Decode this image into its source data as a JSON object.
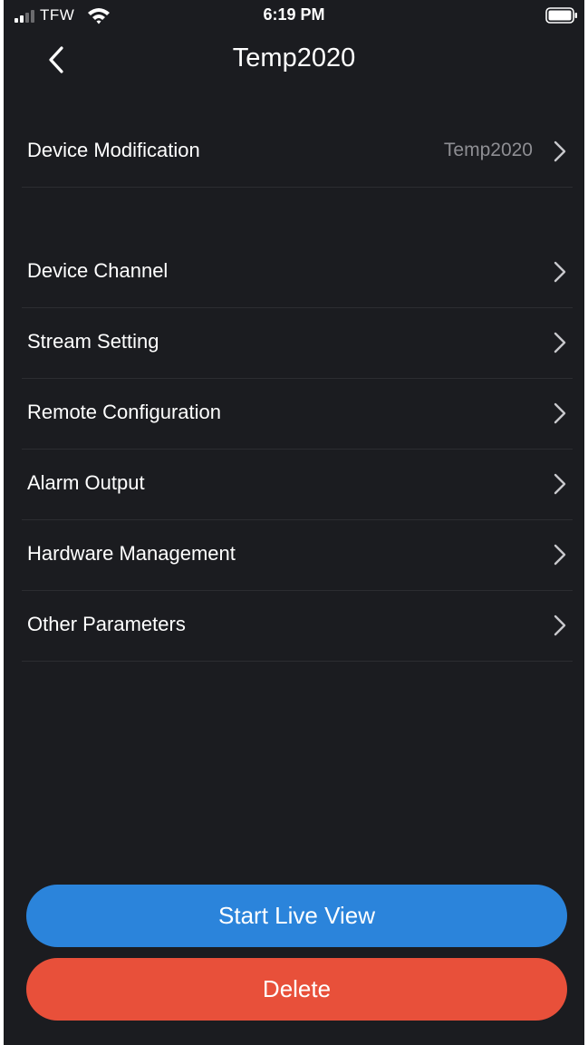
{
  "status_bar": {
    "carrier": "TFW",
    "time": "6:19 PM"
  },
  "header": {
    "title": "Temp2020",
    "back_icon": "chevron-left-icon"
  },
  "device_modification": {
    "label": "Device Modification",
    "value": "Temp2020"
  },
  "menu": {
    "items": [
      {
        "label": "Device Channel"
      },
      {
        "label": "Stream Setting"
      },
      {
        "label": "Remote Configuration"
      },
      {
        "label": "Alarm Output"
      },
      {
        "label": "Hardware Management"
      },
      {
        "label": "Other Parameters"
      }
    ]
  },
  "actions": {
    "start_live_view": "Start Live View",
    "delete": "Delete"
  },
  "colors": {
    "background": "#1b1c20",
    "primary_button": "#2b84db",
    "danger_button": "#e8503a",
    "secondary_text": "#8e8e93",
    "divider": "#2c2d31"
  }
}
